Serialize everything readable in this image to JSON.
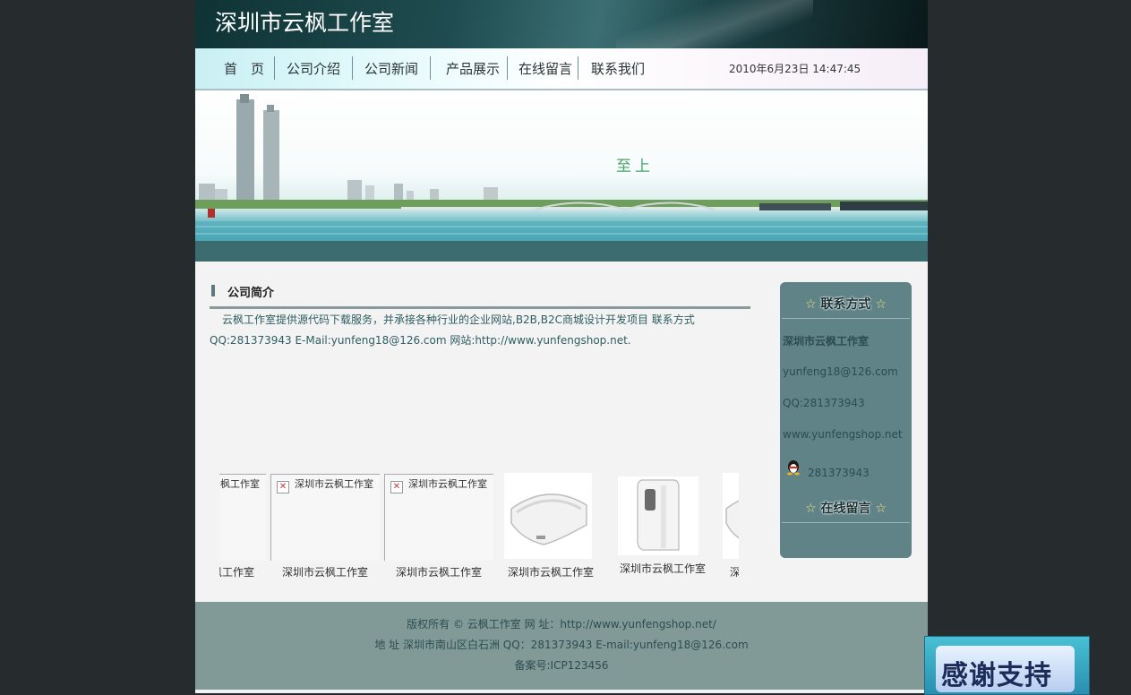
{
  "header": {
    "title": "深圳市云枫工作室"
  },
  "nav": {
    "items": [
      "首　页",
      "公司介绍",
      "公司新闻",
      "产品展示",
      "在线留言",
      "联系我们"
    ],
    "date": "2010年6月23日 14:47:45"
  },
  "banner": {
    "slogan": "至上"
  },
  "intro": {
    "title": "公司简介",
    "line1": "云枫工作室提供源代码下载服务，并承接各种行业的企业网站,B2B,B2C商城设计开发项目 联系方式",
    "line2": "QQ:281373943 E-Mail:yunfeng18@126.com 网站:http://www.yunfengshop.net."
  },
  "gallery": {
    "items": [
      {
        "caption": "深圳市云枫工作室",
        "alt": "深圳市云枫工作室",
        "image": "broken"
      },
      {
        "caption": "深圳市云枫工作室",
        "alt": "深圳市云枫工作室",
        "image": "broken"
      },
      {
        "caption": "深圳市云枫工作室",
        "alt": "深圳市云枫工作室",
        "image": "broken"
      },
      {
        "caption": "深圳市云枫工作室",
        "alt": "",
        "image": "sensor-curved"
      },
      {
        "caption": "深圳市云枫工作室",
        "alt": "",
        "image": "sensor-box"
      },
      {
        "caption": "深圳市云枫工作室",
        "alt": "",
        "image": "sensor-curved"
      }
    ]
  },
  "sidebar": {
    "contact_title": "联系方式",
    "company": "深圳市云枫工作室",
    "email": "yunfeng18@126.com",
    "qq": "QQ:281373943",
    "website": "www.yunfengshop.net",
    "qq_number": "281373943",
    "message_title": "在线留言",
    "star": "☆"
  },
  "footer": {
    "copyright": "版权所有 © 云枫工作室 网 址：http://www.yunfengshop.net/",
    "address": "地 址 深圳市南山区白石洲 QQ：281373943 E-mail:yunfeng18@126.com",
    "icp": "备案号:ICP123456"
  },
  "badge": {
    "text": "感谢支持"
  },
  "colors": {
    "background": "#262b2d",
    "header": "#1f4c50",
    "sidebar": "#5f8387",
    "footer": "#819a98"
  }
}
